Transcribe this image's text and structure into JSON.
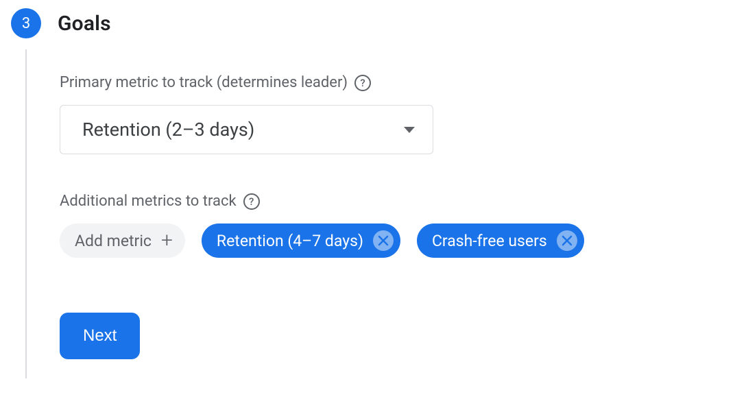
{
  "step": {
    "number": "3",
    "title": "Goals"
  },
  "primary": {
    "label": "Primary metric to track (determines leader)",
    "selected": "Retention (2–3 days)"
  },
  "additional": {
    "label": "Additional metrics to track",
    "add_label": "Add metric",
    "chips": [
      {
        "label": "Retention (4–7 days)"
      },
      {
        "label": "Crash-free users"
      }
    ]
  },
  "buttons": {
    "next": "Next"
  }
}
